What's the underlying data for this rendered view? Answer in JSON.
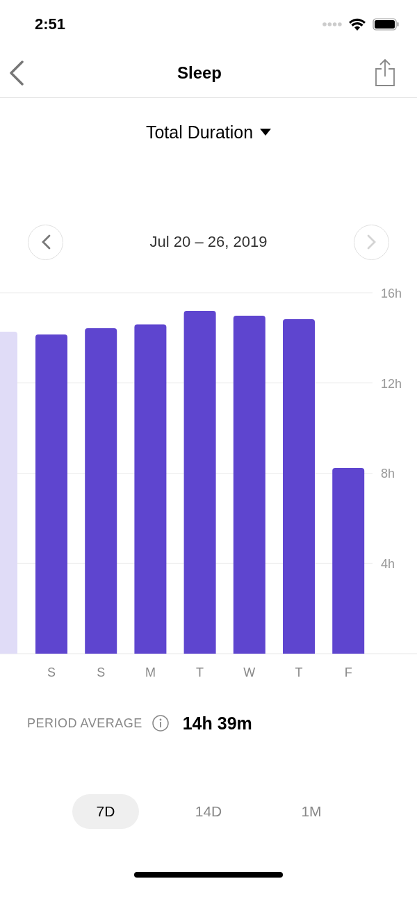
{
  "status_bar": {
    "time": "2:51"
  },
  "nav": {
    "title": "Sleep"
  },
  "metric_picker": {
    "label": "Total Duration"
  },
  "date_nav": {
    "range": "Jul 20 – 26, 2019",
    "previous": {
      "disabled": false
    },
    "next": {
      "disabled": true
    }
  },
  "chart_data": {
    "type": "bar",
    "categories": [
      null,
      "S",
      "S",
      "M",
      "T",
      "W",
      "T",
      "F"
    ],
    "values": [
      14.27,
      14.15,
      14.43,
      14.6,
      15.2,
      14.98,
      14.83,
      8.23
    ],
    "ylim": [
      0,
      16
    ],
    "yticks": [
      {
        "value": 4,
        "label": "4h"
      },
      {
        "value": 8,
        "label": "8h"
      },
      {
        "value": 12,
        "label": "12h"
      },
      {
        "value": 16,
        "label": "16h"
      }
    ],
    "grid": true
  },
  "summary": {
    "label": "PERIOD AVERAGE",
    "value": "14h 39m"
  },
  "ranges": [
    {
      "label": "7D",
      "selected": true
    },
    {
      "label": "14D",
      "selected": false
    },
    {
      "label": "1M",
      "selected": false
    }
  ]
}
